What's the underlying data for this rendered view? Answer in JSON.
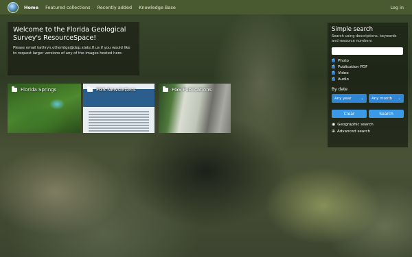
{
  "nav": {
    "items": [
      "Home",
      "Featured collections",
      "Recently added",
      "Knowledge Base"
    ],
    "login": "Log in"
  },
  "welcome": {
    "title": "Welcome to the Florida Geological Survey's ResourceSpace!",
    "text": "Please email kathryn.etheridge@dep.state.fl.us if you would like to request larger versions of any of the images hosted here."
  },
  "collections": [
    "Florida Springs",
    "FGS Newsletters",
    "FGS Publications"
  ],
  "search": {
    "title": "Simple search",
    "subtitle": "Search using descriptions, keywords and resource numbers",
    "input_value": "",
    "types": [
      "Photo",
      "Publication PDF",
      "Video",
      "Audio"
    ],
    "by_date": "By date",
    "year": "Any year",
    "month": "Any month",
    "clear": "Clear",
    "submit": "Search",
    "geo": "Geographic search",
    "advanced": "Advanced search"
  }
}
